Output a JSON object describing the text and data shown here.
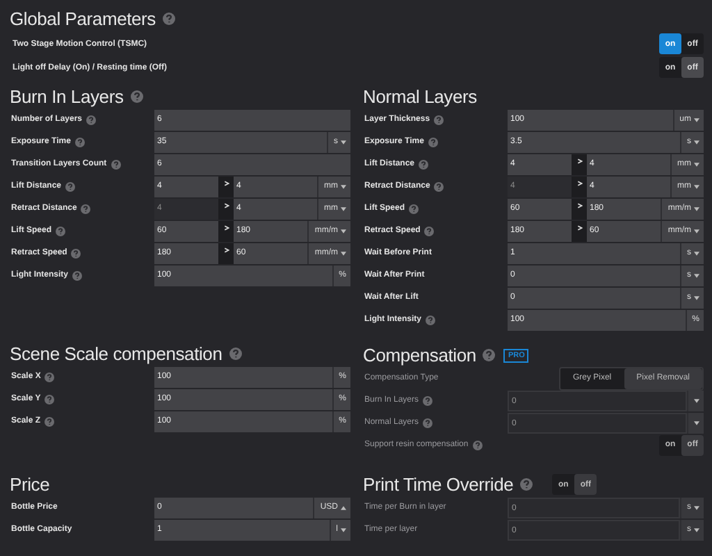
{
  "global": {
    "title": "Global Parameters",
    "help": true,
    "rows": [
      {
        "label": "Two Stage Motion Control (TSMC)",
        "kind": "toggle",
        "options": [
          {
            "label": "on",
            "selected": true
          },
          {
            "label": "off",
            "selected": false
          }
        ],
        "accent": true
      },
      {
        "label": "Light off Delay (On) / Resting time (Off)",
        "kind": "toggle",
        "options": [
          {
            "label": "on",
            "selected": false
          },
          {
            "label": "off",
            "selected": true
          }
        ],
        "accent": false
      }
    ]
  },
  "columns": [
    [
      {
        "title": "Burn In Layers",
        "help": true,
        "disabled": false,
        "rows": [
          {
            "label": "Number of Layers",
            "help": true,
            "kind": "single",
            "value": "6"
          },
          {
            "label": "Exposure Time",
            "help": true,
            "kind": "single",
            "value": "35",
            "unit": "s",
            "dropdown": true
          },
          {
            "label": "Transition Layers Count",
            "help": true,
            "kind": "single",
            "value": "6"
          },
          {
            "label": "Lift Distance",
            "help": true,
            "kind": "range",
            "from": "4",
            "from_disabled": false,
            "to": "4",
            "unit": "mm",
            "dropdown": true
          },
          {
            "label": "Retract Distance",
            "help": true,
            "kind": "range",
            "from": "4",
            "from_disabled": true,
            "to": "4",
            "unit": "mm",
            "dropdown": true
          },
          {
            "label": "Lift Speed",
            "help": true,
            "kind": "range",
            "from": "60",
            "from_disabled": false,
            "to": "180",
            "unit": "mm/m",
            "dropdown": true
          },
          {
            "label": "Retract Speed",
            "help": true,
            "kind": "range",
            "from": "180",
            "from_disabled": false,
            "to": "60",
            "unit": "mm/m",
            "dropdown": true
          },
          {
            "label": "Light Intensity",
            "help": true,
            "kind": "single",
            "value": "100",
            "unit": "%",
            "dropdown": false
          }
        ]
      },
      {
        "title": "Scene Scale compensation",
        "help": true,
        "disabled": false,
        "rows": [
          {
            "label": "Scale X",
            "help": true,
            "kind": "single",
            "value": "100",
            "unit": "%",
            "dropdown": false
          },
          {
            "label": "Scale Y",
            "help": true,
            "kind": "single",
            "value": "100",
            "unit": "%",
            "dropdown": false
          },
          {
            "label": "Scale Z",
            "help": true,
            "kind": "single",
            "value": "100",
            "unit": "%",
            "dropdown": false
          }
        ]
      },
      {
        "title": "Price",
        "help": false,
        "disabled": false,
        "rows": [
          {
            "label": "Bottle Price",
            "help": false,
            "kind": "single",
            "value": "0",
            "unit": "USD",
            "dropdown": true,
            "caret_up": true
          },
          {
            "label": "Bottle Capacity",
            "help": false,
            "kind": "single",
            "value": "1",
            "unit": "l",
            "dropdown": true,
            "caret_up": false
          }
        ]
      }
    ],
    [
      {
        "title": "Normal Layers",
        "help": false,
        "disabled": false,
        "rows": [
          {
            "label": "Layer Thickness",
            "help": true,
            "kind": "single",
            "value": "100",
            "unit": "um",
            "dropdown": true
          },
          {
            "label": "Exposure Time",
            "help": true,
            "kind": "single",
            "value": "3.5",
            "unit": "s",
            "dropdown": true
          },
          {
            "label": "Lift Distance",
            "help": true,
            "kind": "range",
            "from": "4",
            "from_disabled": false,
            "to": "4",
            "unit": "mm",
            "dropdown": true
          },
          {
            "label": "Retract Distance",
            "help": true,
            "kind": "range",
            "from": "4",
            "from_disabled": true,
            "to": "4",
            "unit": "mm",
            "dropdown": true
          },
          {
            "label": "Lift Speed",
            "help": true,
            "kind": "range",
            "from": "60",
            "from_disabled": false,
            "to": "180",
            "unit": "mm/m",
            "dropdown": true
          },
          {
            "label": "Retract Speed",
            "help": true,
            "kind": "range",
            "from": "180",
            "from_disabled": false,
            "to": "60",
            "unit": "mm/m",
            "dropdown": true
          },
          {
            "label": "Wait Before Print",
            "help": false,
            "kind": "single",
            "value": "1",
            "unit": "s",
            "dropdown": true
          },
          {
            "label": "Wait After Print",
            "help": false,
            "kind": "single",
            "value": "0",
            "unit": "s",
            "dropdown": true
          },
          {
            "label": "Wait After Lift",
            "help": false,
            "kind": "single",
            "value": "0",
            "unit": "s",
            "dropdown": true
          },
          {
            "label": "Light Intensity",
            "help": true,
            "kind": "single",
            "value": "100",
            "unit": "%",
            "dropdown": false
          }
        ]
      },
      {
        "title": "Compensation",
        "help": true,
        "badge": "PRO",
        "disabled": true,
        "rows": [
          {
            "label": "Compensation Type",
            "help": false,
            "kind": "segmented",
            "options": [
              {
                "label": "Grey Pixel",
                "selected": false
              },
              {
                "label": "Pixel Removal",
                "selected": true
              }
            ]
          },
          {
            "label": "Burn In Layers",
            "help": true,
            "kind": "single",
            "value": "0",
            "dropdown": true
          },
          {
            "label": "Normal Layers",
            "help": true,
            "kind": "single",
            "value": "0",
            "dropdown": true
          },
          {
            "label": "Support resin compensation",
            "help": true,
            "kind": "toggle",
            "options": [
              {
                "label": "on",
                "selected": false
              },
              {
                "label": "off",
                "selected": true
              }
            ],
            "accent": false
          }
        ]
      },
      {
        "title": "Print Time Override",
        "help": true,
        "toggle": {
          "options": [
            {
              "label": "on",
              "selected": false
            },
            {
              "label": "off",
              "selected": true
            }
          ]
        },
        "disabled": true,
        "rows": [
          {
            "label": "Time per Burn in layer",
            "help": false,
            "kind": "single",
            "value": "0",
            "unit": "s",
            "dropdown": true
          },
          {
            "label": "Time per layer",
            "help": false,
            "kind": "single",
            "value": "0",
            "unit": "s",
            "dropdown": true
          }
        ]
      }
    ]
  ]
}
